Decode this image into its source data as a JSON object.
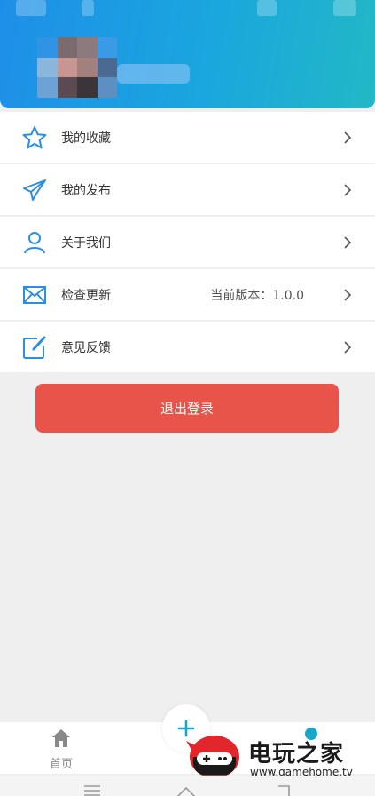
{
  "header": {
    "user_avatar_name": "avatar",
    "username": ""
  },
  "menu": [
    {
      "label": "我的收藏",
      "icon": "star-icon",
      "extra": ""
    },
    {
      "label": "我的发布",
      "icon": "paper-plane-icon",
      "extra": ""
    },
    {
      "label": "关于我们",
      "icon": "user-icon",
      "extra": ""
    },
    {
      "label": "检查更新",
      "icon": "envelope-icon",
      "extra": "当前版本：1.0.0"
    },
    {
      "label": "意见反馈",
      "icon": "edit-icon",
      "extra": ""
    }
  ],
  "logout_label": "退出登录",
  "tabbar": {
    "home_label": "首页"
  },
  "watermark": {
    "title": "电玩之家",
    "url": "www.gamehome.tv"
  },
  "colors": {
    "header_start": "#1e8fe8",
    "header_end": "#22b8c6",
    "icon": "#2d8ee0",
    "logout": "#e85449"
  }
}
